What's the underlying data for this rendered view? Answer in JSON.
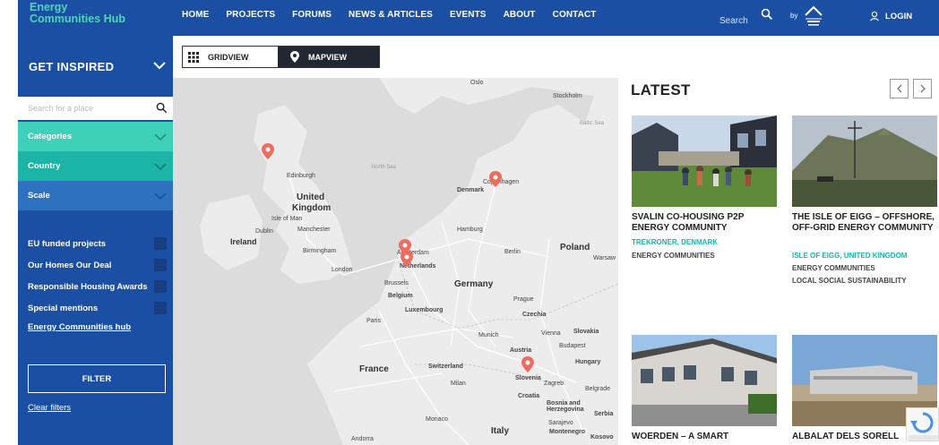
{
  "header": {
    "logo_line1": "Energy",
    "logo_line2": "Communities Hub",
    "nav": [
      "HOME",
      "PROJECTS",
      "FORUMS",
      "NEWS & ARTICLES",
      "EVENTS",
      "ABOUT",
      "CONTACT"
    ],
    "search_label": "Search",
    "by_label": "by",
    "login_label": "LOGIN"
  },
  "sidebar": {
    "get_inspired": "GET INSPIRED",
    "search_placeholder": "Search for a place",
    "accordions": [
      "Categories",
      "Country",
      "Scale"
    ],
    "checkboxes": [
      "EU funded projects",
      "Our Homes Our Deal",
      "Responsible Housing Awards",
      "Special mentions"
    ],
    "hub_link": "Energy Communities hub",
    "filter_button": "FILTER",
    "clear_filters": "Clear filters"
  },
  "view_toggle": {
    "grid": "GRIDVIEW",
    "map": "MAPVIEW"
  },
  "map": {
    "labels": {
      "oslo": "Oslo",
      "stockholm": "Stockholm",
      "baltic": "Baltic Sea",
      "north_sea": "North Sea",
      "edinburgh": "Edinburgh",
      "uk1": "United",
      "uk2": "Kingdom",
      "isle_of_man": "Isle of Man",
      "dublin": "Dublin",
      "manchester": "Manchester",
      "ireland": "Ireland",
      "birmingham": "Birmingham",
      "london": "London",
      "denmark": "Denmark",
      "copenhagen": "Copenhagen",
      "hamburg": "Hamburg",
      "amsterdam": "Amsterdam",
      "netherlands": "Netherlands",
      "berlin": "Berlin",
      "poland": "Poland",
      "warsaw": "Warsaw",
      "brussels": "Brussels",
      "belgium": "Belgium",
      "germany": "Germany",
      "luxembourg": "Luxembourg",
      "prague": "Prague",
      "czechia": "Czechia",
      "paris": "Paris",
      "munich": "Munich",
      "vienna": "Vienna",
      "slovakia": "Slovakia",
      "budapest": "Budapest",
      "austria": "Austria",
      "hungary": "Hungary",
      "france": "France",
      "switzerland": "Switzerland",
      "slovenia": "Slovenia",
      "zagreb": "Zagreb",
      "milan": "Milan",
      "croatia": "Croatia",
      "belgrade": "Belgrade",
      "bosnia": "Bosnia and",
      "herzegovina": "Herzegovina",
      "serbia": "Serbia",
      "monaco": "Monaco",
      "sarajevo": "Sarajevo",
      "italy": "Italy",
      "montenegro": "Montenegro",
      "andorra": "Andorra",
      "kosovo": "Kosovo"
    }
  },
  "latest": {
    "title": "LATEST",
    "prev_icon": "chevron-left-icon",
    "next_icon": "chevron-right-icon",
    "cards": [
      {
        "title": "SVALIN CO-HOUSING P2P ENERGY COMMUNITY",
        "location": "TREKRONER, DENMARK",
        "tags": [
          "ENERGY COMMUNITIES"
        ]
      },
      {
        "title": "THE ISLE OF EIGG – OFFSHORE, OFF-GRID ENERGY COMMUNITY",
        "location": "ISLE OF EIGG, UNITED KINGDOM",
        "tags": [
          "ENERGY COMMUNITIES",
          "LOCAL SOCIAL SUSTAINABILITY"
        ]
      },
      {
        "title": "WOERDEN – A SMART",
        "location": "",
        "tags": []
      },
      {
        "title": "ALBALAT DELS SORELL",
        "location": "",
        "tags": []
      }
    ]
  },
  "colors": {
    "brand_blue": "#1a4fa3",
    "teal": "#3ed0b8",
    "teal_dark": "#1db4a8",
    "pin": "#ef6b5e"
  }
}
